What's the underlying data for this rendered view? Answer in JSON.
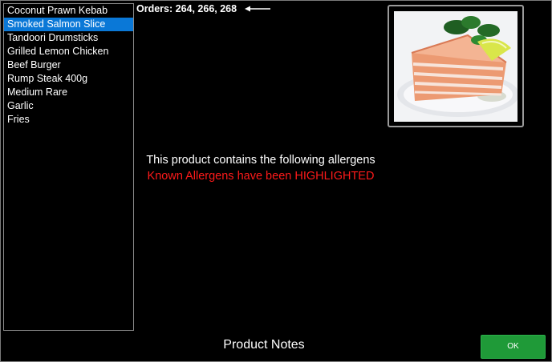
{
  "products": [
    {
      "label": "Coconut Prawn Kebab",
      "selected": false
    },
    {
      "label": "Smoked Salmon Slice",
      "selected": true
    },
    {
      "label": "Tandoori Drumsticks",
      "selected": false
    },
    {
      "label": "Grilled Lemon Chicken",
      "selected": false
    },
    {
      "label": "Beef Burger",
      "selected": false
    },
    {
      "label": "Rump Steak 400g",
      "selected": false
    },
    {
      "label": "Medium Rare",
      "selected": false
    },
    {
      "label": "Garlic",
      "selected": false
    },
    {
      "label": "Fries",
      "selected": false
    }
  ],
  "orders": {
    "text": "Orders: 264, 266, 268",
    "arrow_icon": "left-arrow-icon"
  },
  "allergens": {
    "title": "This product contains the following allergens",
    "note": "Known Allergens have been HIGHLIGHTED",
    "note_color": "#ff1a1a"
  },
  "footer": {
    "notes_label": "Product Notes",
    "ok_label": "OK"
  },
  "colors": {
    "selection": "#0a78d7",
    "ok_button": "#1f9a38",
    "background": "#000000"
  }
}
